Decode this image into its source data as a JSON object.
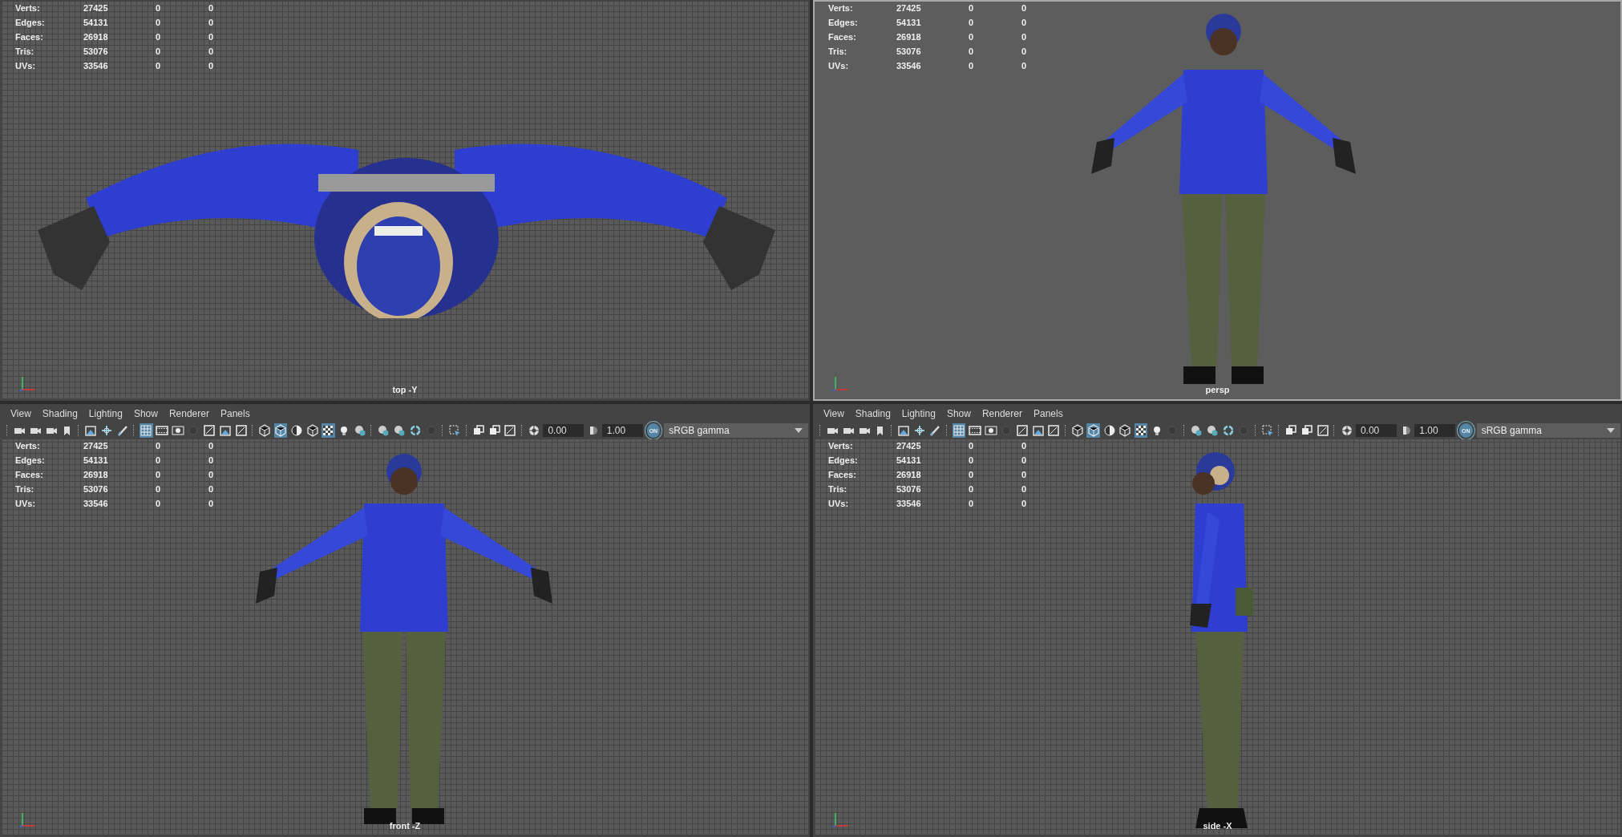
{
  "panes": [
    {
      "kind": "top",
      "label": "top -Y",
      "active": false,
      "grid": true,
      "stats": [
        {
          "label": "Verts:",
          "values": [
            "27425",
            "0",
            "0"
          ]
        },
        {
          "label": "Edges:",
          "values": [
            "54131",
            "0",
            "0"
          ]
        },
        {
          "label": "Faces:",
          "values": [
            "26918",
            "0",
            "0"
          ]
        },
        {
          "label": "Tris:",
          "values": [
            "53076",
            "0",
            "0"
          ]
        },
        {
          "label": "UVs:",
          "values": [
            "33546",
            "0",
            "0"
          ]
        }
      ]
    },
    {
      "kind": "persp",
      "label": "persp",
      "active": true,
      "grid": false,
      "stats": [
        {
          "label": "Verts:",
          "values": [
            "27425",
            "0",
            "0"
          ]
        },
        {
          "label": "Edges:",
          "values": [
            "54131",
            "0",
            "0"
          ]
        },
        {
          "label": "Faces:",
          "values": [
            "26918",
            "0",
            "0"
          ]
        },
        {
          "label": "Tris:",
          "values": [
            "53076",
            "0",
            "0"
          ]
        },
        {
          "label": "UVs:",
          "values": [
            "33546",
            "0",
            "0"
          ]
        }
      ]
    },
    {
      "kind": "front",
      "label": "front -Z",
      "active": false,
      "grid": true,
      "menu": [
        "View",
        "Shading",
        "Lighting",
        "Show",
        "Renderer",
        "Panels"
      ],
      "toolbar": {
        "groups": [
          [
            {
              "kind": "camera",
              "selected": false
            },
            {
              "kind": "camera",
              "selected": false
            },
            {
              "kind": "camera",
              "selected": false
            },
            {
              "kind": "bookmark",
              "selected": false
            }
          ],
          [
            {
              "kind": "image",
              "selected": false
            },
            {
              "kind": "move",
              "selected": false
            },
            {
              "kind": "pen",
              "selected": false
            }
          ],
          [
            {
              "kind": "grid",
              "selected": true
            },
            {
              "kind": "film",
              "selected": false
            },
            {
              "kind": "dot",
              "selected": false
            },
            {
              "kind": "shadow",
              "selected": false
            },
            {
              "kind": "frame",
              "selected": false
            },
            {
              "kind": "image",
              "selected": false
            },
            {
              "kind": "frame",
              "selected": false
            }
          ],
          [
            {
              "kind": "cube",
              "selected": false
            },
            {
              "kind": "cube",
              "selected": true
            },
            {
              "kind": "half",
              "selected": false
            },
            {
              "kind": "cube",
              "selected": false
            },
            {
              "kind": "checker",
              "selected": true
            },
            {
              "kind": "light",
              "selected": false
            },
            {
              "kind": "sphere",
              "selected": false
            }
          ],
          [
            {
              "kind": "sphere",
              "selected": false
            },
            {
              "kind": "sphere",
              "selected": false
            },
            {
              "kind": "ring",
              "selected": false
            },
            {
              "kind": "shadow",
              "selected": false
            }
          ],
          [
            {
              "kind": "select",
              "selected": false
            }
          ],
          [
            {
              "kind": "layers",
              "selected": false
            },
            {
              "kind": "layers",
              "selected": false
            },
            {
              "kind": "frame",
              "selected": false
            }
          ]
        ],
        "exposure": "0.00",
        "gamma": "1.00",
        "toggle": "ON",
        "color_space": "sRGB gamma"
      },
      "stats": [
        {
          "label": "Verts:",
          "values": [
            "27425",
            "0",
            "0"
          ]
        },
        {
          "label": "Edges:",
          "values": [
            "54131",
            "0",
            "0"
          ]
        },
        {
          "label": "Faces:",
          "values": [
            "26918",
            "0",
            "0"
          ]
        },
        {
          "label": "Tris:",
          "values": [
            "53076",
            "0",
            "0"
          ]
        },
        {
          "label": "UVs:",
          "values": [
            "33546",
            "0",
            "0"
          ]
        }
      ]
    },
    {
      "kind": "side",
      "label": "side -X",
      "active": false,
      "grid": true,
      "menu": [
        "View",
        "Shading",
        "Lighting",
        "Show",
        "Renderer",
        "Panels"
      ],
      "toolbar": {
        "groups": [
          [
            {
              "kind": "camera",
              "selected": false
            },
            {
              "kind": "camera",
              "selected": false
            },
            {
              "kind": "camera",
              "selected": false
            },
            {
              "kind": "bookmark",
              "selected": false
            }
          ],
          [
            {
              "kind": "image",
              "selected": false
            },
            {
              "kind": "move",
              "selected": false
            },
            {
              "kind": "pen",
              "selected": false
            }
          ],
          [
            {
              "kind": "grid",
              "selected": true
            },
            {
              "kind": "film",
              "selected": false
            },
            {
              "kind": "dot",
              "selected": false
            },
            {
              "kind": "shadow",
              "selected": false
            },
            {
              "kind": "frame",
              "selected": false
            },
            {
              "kind": "image",
              "selected": false
            },
            {
              "kind": "frame",
              "selected": false
            }
          ],
          [
            {
              "kind": "cube",
              "selected": false
            },
            {
              "kind": "cube",
              "selected": true
            },
            {
              "kind": "half",
              "selected": false
            },
            {
              "kind": "cube",
              "selected": false
            },
            {
              "kind": "checker",
              "selected": true
            },
            {
              "kind": "light",
              "selected": false
            },
            {
              "kind": "shadow",
              "selected": false
            }
          ],
          [
            {
              "kind": "sphere",
              "selected": false
            },
            {
              "kind": "sphere",
              "selected": false
            },
            {
              "kind": "ring",
              "selected": false
            },
            {
              "kind": "shadow",
              "selected": false
            }
          ],
          [
            {
              "kind": "select",
              "selected": false
            }
          ],
          [
            {
              "kind": "layers",
              "selected": false
            },
            {
              "kind": "layers",
              "selected": false
            },
            {
              "kind": "frame",
              "selected": false
            }
          ]
        ],
        "exposure": "0.00",
        "gamma": "1.00",
        "toggle": "ON",
        "color_space": "sRGB gamma"
      },
      "stats": [
        {
          "label": "Verts:",
          "values": [
            "27425",
            "0",
            "0"
          ]
        },
        {
          "label": "Edges:",
          "values": [
            "54131",
            "0",
            "0"
          ]
        },
        {
          "label": "Faces:",
          "values": [
            "26918",
            "0",
            "0"
          ]
        },
        {
          "label": "Tris:",
          "values": [
            "53076",
            "0",
            "0"
          ]
        },
        {
          "label": "UVs:",
          "values": [
            "33546",
            "0",
            "0"
          ]
        }
      ]
    }
  ]
}
